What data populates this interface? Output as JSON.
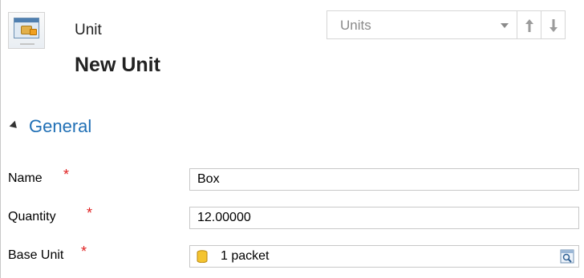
{
  "header": {
    "entity_type": "Unit",
    "record_title": "New Unit"
  },
  "navigation": {
    "selector_value": "Units"
  },
  "section": {
    "title": "General"
  },
  "fields": {
    "name": {
      "label": "Name",
      "required_marker": "*",
      "value": "Box"
    },
    "quantity": {
      "label": "Quantity",
      "required_marker": "*",
      "value": "12.00000"
    },
    "base_unit": {
      "label": "Base Unit",
      "required_marker": "*",
      "value": "1 packet"
    }
  },
  "icons": {
    "entity": "unit-entity-icon",
    "lookup_record": "database-stack-icon",
    "lookup_button": "lookup-search-icon",
    "previous": "arrow-up-icon",
    "next": "arrow-down-icon"
  },
  "colors": {
    "accent": "#1f6fb5",
    "required": "#e02020"
  }
}
